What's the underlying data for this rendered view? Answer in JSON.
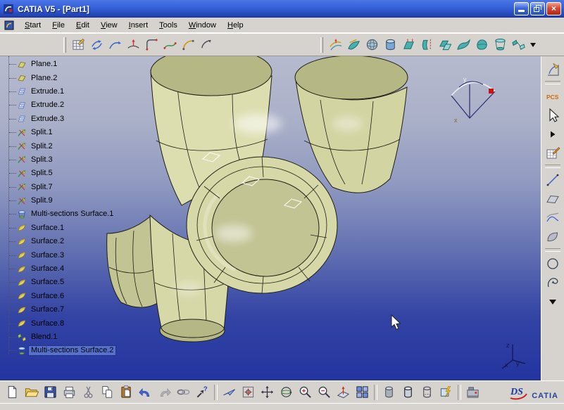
{
  "window": {
    "title": "CATIA V5 - [Part1]"
  },
  "menu": {
    "items": [
      "Start",
      "File",
      "Edit",
      "View",
      "Insert",
      "Tools",
      "Window",
      "Help"
    ]
  },
  "toolbars": {
    "top_left": [
      "sketch-grid-icon",
      "exchange-arrows-icon",
      "projection-curve-icon",
      "intersection-curve-icon",
      "corner-icon",
      "connect-curve-icon",
      "circle-arc-icon",
      "conic-curve-icon"
    ],
    "top_right": [
      "offset-curve-icon",
      "swept-curve-icon",
      "sphere-surface-icon",
      "cylinder-surface-icon",
      "extrude-surface-icon",
      "revolve-surface-icon",
      "offset-surface-icon",
      "swept-surface-icon",
      "fill-surface-icon",
      "multi-sections-surface-icon",
      "blend-surface-icon"
    ],
    "right": [
      "sketcher-icon",
      "|",
      "pcs-icon",
      "select-arrow-icon",
      "flyout-arrow-icon",
      "paint-grid-icon",
      "|",
      "line-icon",
      "plane-icon",
      "combined-curves-icon",
      "surface-patch-icon",
      "|",
      "circle-icon",
      "helix-icon",
      "more-tools-icon"
    ],
    "bottom": [
      "new-document-icon",
      "open-icon",
      "save-icon",
      "print-icon",
      "cut-icon",
      "copy-icon",
      "paste-icon",
      "undo-icon",
      "redo-icon",
      "link-icon",
      "context-help-icon",
      "|",
      "fly-mode-icon",
      "fit-all-icon",
      "pan-icon",
      "rotate-icon",
      "zoom-in-icon",
      "zoom-out-icon",
      "normal-view-icon",
      "multi-view-icon",
      "|",
      "shaded-view-icon",
      "shaded-edges-view-icon",
      "wireframe-view-icon",
      "apply-material-icon",
      "|",
      "catalog-icon"
    ]
  },
  "tree": {
    "items": [
      {
        "label": "Plane.1",
        "icon": "plane-icon",
        "selected": false
      },
      {
        "label": "Plane.2",
        "icon": "plane-icon",
        "selected": false
      },
      {
        "label": "Extrude.1",
        "icon": "extrude-icon",
        "selected": false
      },
      {
        "label": "Extrude.2",
        "icon": "extrude-icon",
        "selected": false
      },
      {
        "label": "Extrude.3",
        "icon": "extrude-icon",
        "selected": false
      },
      {
        "label": "Split.1",
        "icon": "split-icon",
        "selected": false
      },
      {
        "label": "Split.2",
        "icon": "split-icon",
        "selected": false
      },
      {
        "label": "Split.3",
        "icon": "split-icon",
        "selected": false
      },
      {
        "label": "Split.5",
        "icon": "split-icon",
        "selected": false
      },
      {
        "label": "Split.7",
        "icon": "split-icon",
        "selected": false
      },
      {
        "label": "Split.9",
        "icon": "split-icon",
        "selected": false
      },
      {
        "label": "Multi-sections Surface.1",
        "icon": "multisections-icon",
        "selected": false
      },
      {
        "label": "Surface.1",
        "icon": "surface-icon",
        "selected": false
      },
      {
        "label": "Surface.2",
        "icon": "surface-icon",
        "selected": false
      },
      {
        "label": "Surface.3",
        "icon": "surface-icon",
        "selected": false
      },
      {
        "label": "Surface.4",
        "icon": "surface-icon",
        "selected": false
      },
      {
        "label": "Surface.5",
        "icon": "surface-icon",
        "selected": false
      },
      {
        "label": "Surface.6",
        "icon": "surface-icon",
        "selected": false
      },
      {
        "label": "Surface.7",
        "icon": "surface-icon",
        "selected": false
      },
      {
        "label": "Surface.8",
        "icon": "surface-icon",
        "selected": false
      },
      {
        "label": "Blend.1",
        "icon": "blend-icon",
        "selected": false
      },
      {
        "label": "Multi-sections Surface.2",
        "icon": "multisections-icon",
        "selected": true
      }
    ]
  },
  "viewport": {
    "axis_labels": {
      "x": "x",
      "y": "y",
      "z": "z"
    },
    "compass_labels": {
      "x": "x",
      "y": "y"
    }
  },
  "logo": {
    "ds": "DS",
    "catia": "CATIA"
  },
  "colors": {
    "selection": "#5571cc",
    "surface": "#d6d8a8",
    "viewport_top": "#b6bace",
    "viewport_bottom": "#2434a0"
  }
}
